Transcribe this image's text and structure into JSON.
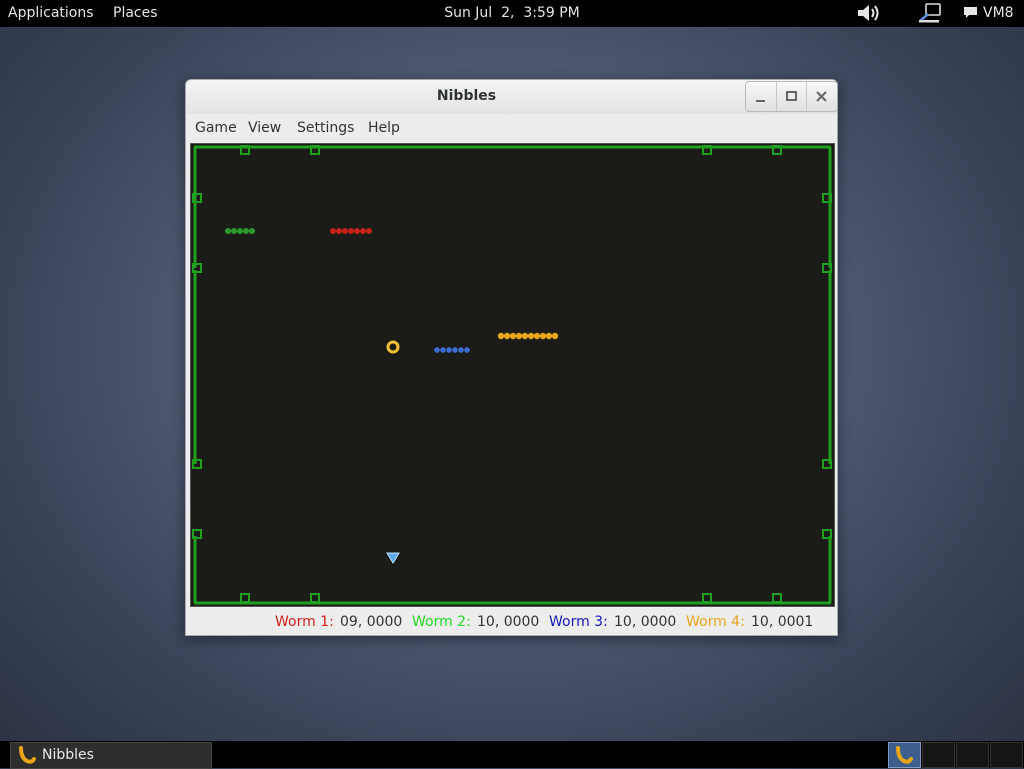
{
  "top_panel": {
    "applications_label": "Applications",
    "places_label": "Places",
    "clock": "Sun Jul  2,  3:59 PM",
    "user": "VM8"
  },
  "window": {
    "title": "Nibbles",
    "menu": [
      "Game",
      "View",
      "Settings",
      "Help"
    ]
  },
  "game": {
    "colors": {
      "wall": "#1f9e1f",
      "arena_bg": "#1b1c17",
      "worm_red": "#c8201a",
      "worm_green": "#2b9a2b",
      "worm_blue": "#3c6ed6",
      "worm_yellow": "#e8a515",
      "bonus_ring": "#f0c233",
      "diamond": "#5fa9e8"
    },
    "items": [
      "yellow-ring-bonus",
      "blue-diamond-bonus"
    ]
  },
  "status": {
    "worms": [
      {
        "label": "Worm 1:",
        "value": "09, 0000",
        "color": "#d02020"
      },
      {
        "label": "Worm 2:",
        "value": "10, 0000",
        "color": "#27d827"
      },
      {
        "label": "Worm 3:",
        "value": "10, 0000",
        "color": "#1818b8"
      },
      {
        "label": "Worm 4:",
        "value": "10, 0001",
        "color": "#e8a520"
      }
    ]
  },
  "taskbar": {
    "task_label": "Nibbles",
    "workspaces": 4,
    "active_workspace": 1
  }
}
